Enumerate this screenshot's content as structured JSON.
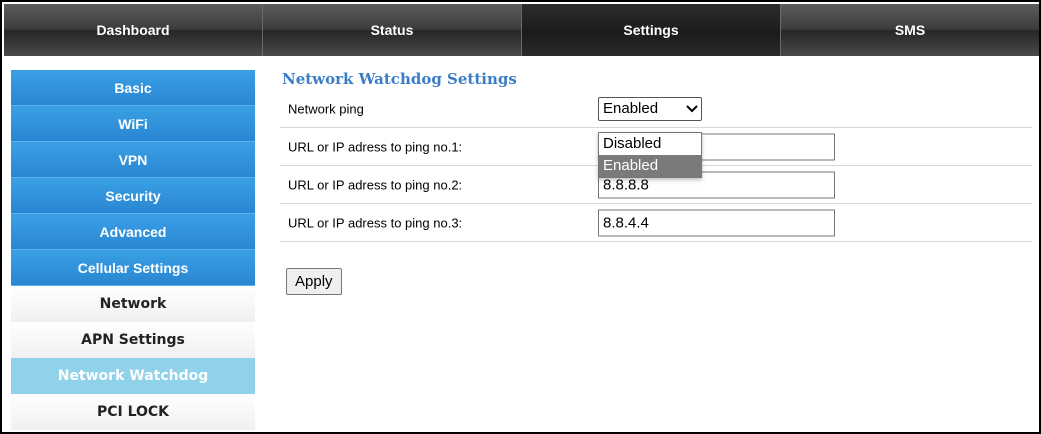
{
  "nav": {
    "tabs": [
      {
        "label": "Dashboard"
      },
      {
        "label": "Status"
      },
      {
        "label": "Settings"
      },
      {
        "label": "SMS"
      }
    ],
    "active_tab": "Settings"
  },
  "sidebar": {
    "items": [
      {
        "label": "Basic"
      },
      {
        "label": "WiFi"
      },
      {
        "label": "VPN"
      },
      {
        "label": "Security"
      },
      {
        "label": "Advanced"
      },
      {
        "label": "Cellular Settings"
      },
      {
        "label": "Network"
      },
      {
        "label": "APN Settings"
      },
      {
        "label": "Network Watchdog"
      },
      {
        "label": "PCI LOCK"
      }
    ],
    "active_item": "Network Watchdog"
  },
  "main": {
    "title": "Network Watchdog Settings",
    "ping": {
      "label": "Network ping",
      "value": "Enabled"
    },
    "url1": {
      "label": "URL or IP adress to ping no.1:",
      "value": ""
    },
    "url2": {
      "label": "URL or IP adress to ping no.2:",
      "value": "8.8.8.8"
    },
    "url3": {
      "label": "URL or IP adress to ping no.3:",
      "value": "8.8.4.4"
    },
    "apply_label": "Apply"
  },
  "dropdown": {
    "options": [
      {
        "label": "Disabled"
      },
      {
        "label": "Enabled"
      }
    ],
    "highlighted": "Enabled"
  },
  "colors": {
    "accent_blue": "#2a86d2",
    "title_blue": "#3b7ec7",
    "active_sub": "#8fd2ea"
  }
}
